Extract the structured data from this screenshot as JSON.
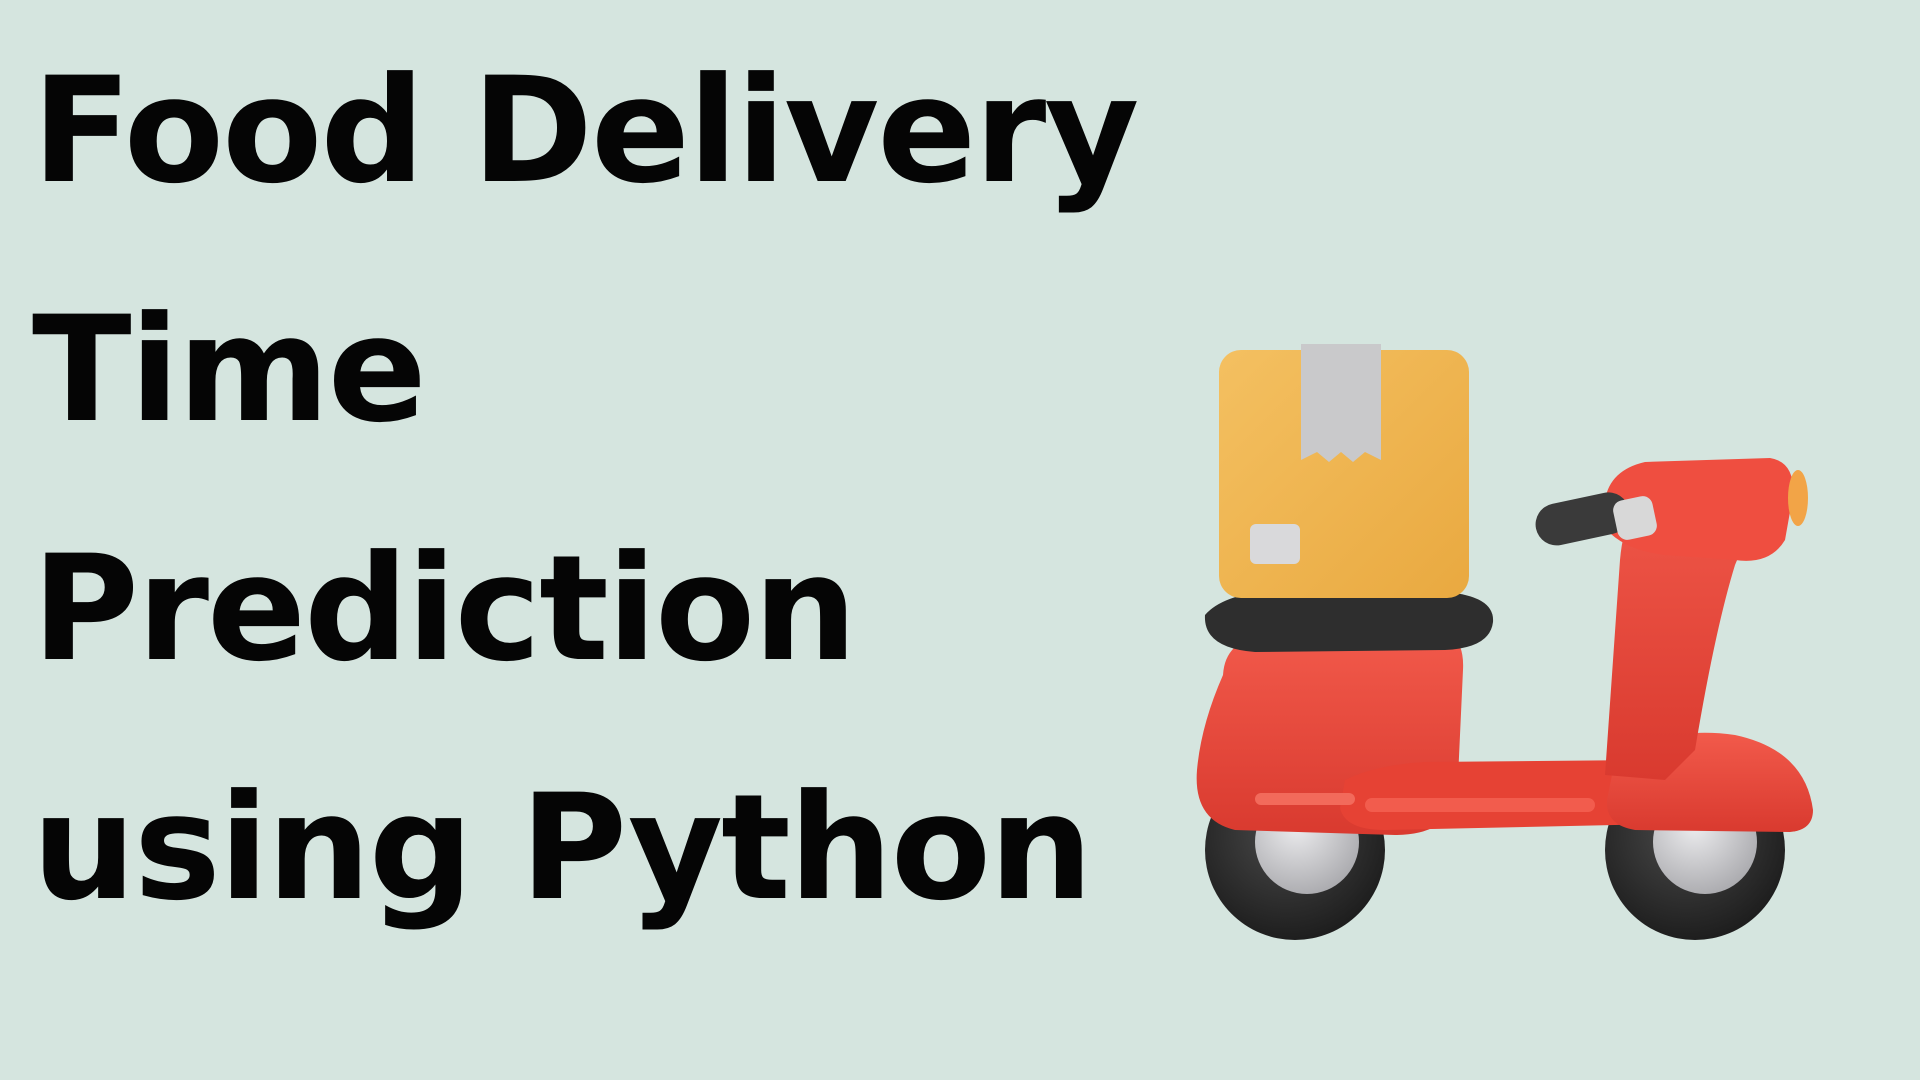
{
  "title": {
    "lines": [
      "Food Delivery",
      "Time",
      "Prediction",
      "using Python"
    ]
  },
  "illustration": {
    "icon": "delivery-scooter-icon",
    "colors": {
      "background": "#d5e5df",
      "scooter_body": "#ee4b3e",
      "box": "#f0b24d",
      "tape": "#c9c9cb",
      "seat": "#2e2e2e",
      "tire": "#2a2a2a",
      "hub": "#c7c7c9"
    }
  }
}
